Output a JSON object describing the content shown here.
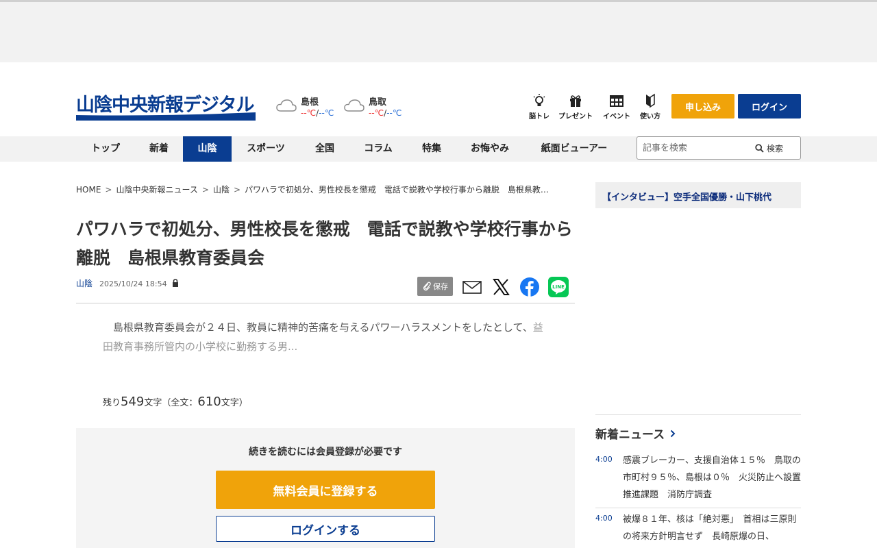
{
  "header": {
    "logo_text": "山陰中央新報デジタル",
    "weather": [
      {
        "city": "島根",
        "hi": "--℃",
        "sep": "/",
        "lo": "--℃"
      },
      {
        "city": "鳥取",
        "hi": "--℃",
        "sep": "/",
        "lo": "--℃"
      }
    ],
    "links": [
      {
        "label": "脳トレ",
        "icon": "lightbulb-icon"
      },
      {
        "label": "プレゼント",
        "icon": "gift-icon"
      },
      {
        "label": "イベント",
        "icon": "calendar-icon"
      },
      {
        "label": "使い方",
        "icon": "guide-icon"
      }
    ],
    "apply_label": "申し込み",
    "login_label": "ログイン"
  },
  "nav": {
    "items": [
      "トップ",
      "新着",
      "山陰",
      "スポーツ",
      "全国",
      "コラム",
      "特集",
      "お悔やみ",
      "紙面ビューアー"
    ],
    "active": "山陰",
    "search_placeholder": "記事を検索",
    "search_label": "検索"
  },
  "breadcrumb": {
    "items": [
      "HOME",
      "山陰中央新報ニュース",
      "山陰",
      "パワハラで初処分、男性校長を懲戒　電話で説教や学校行事から離脱　島根県教…"
    ],
    "sep": ">"
  },
  "article": {
    "title": "パワハラで初処分、男性校長を懲戒　電話で説教や学校行事から離脱　島根県教育委員会",
    "category": "山陰",
    "date": "2025/10/24 18:54",
    "save_label": "保存",
    "lead": "島根県教育委員会が２４日、教員に精神的苦痛を与えるパワーハラスメントをしたとして、",
    "lead_fade": "益田教育事務所管内の小学校に勤務する男...",
    "remaining_prefix": "残り",
    "remaining_count": "549",
    "remaining_mid": "文字（全文：",
    "total_count": "610",
    "remaining_suffix": "文字）"
  },
  "paywall": {
    "message": "続きを読むには会員登録が必要です",
    "register_label": "無料会員に登録する",
    "login_label": "ログインする"
  },
  "sidebar": {
    "banner": "【インタビュー】空手全国優勝・山下桃代",
    "heading": "新着ニュース",
    "news": [
      {
        "time": "4:00",
        "text": "感震ブレーカー、支援自治体１５％　鳥取の市町村９５％、島根は０％　火災防止へ設置推進課題　消防庁調査"
      },
      {
        "time": "4:00",
        "text": "被爆８１年、核は「絶対悪」　首相は三原則の将来方針明言せず　長崎原爆の日、"
      }
    ]
  },
  "colors": {
    "brand": "#0a3d91",
    "accent": "#f0a30a",
    "facebook": "#1877f2",
    "line": "#06c755"
  }
}
